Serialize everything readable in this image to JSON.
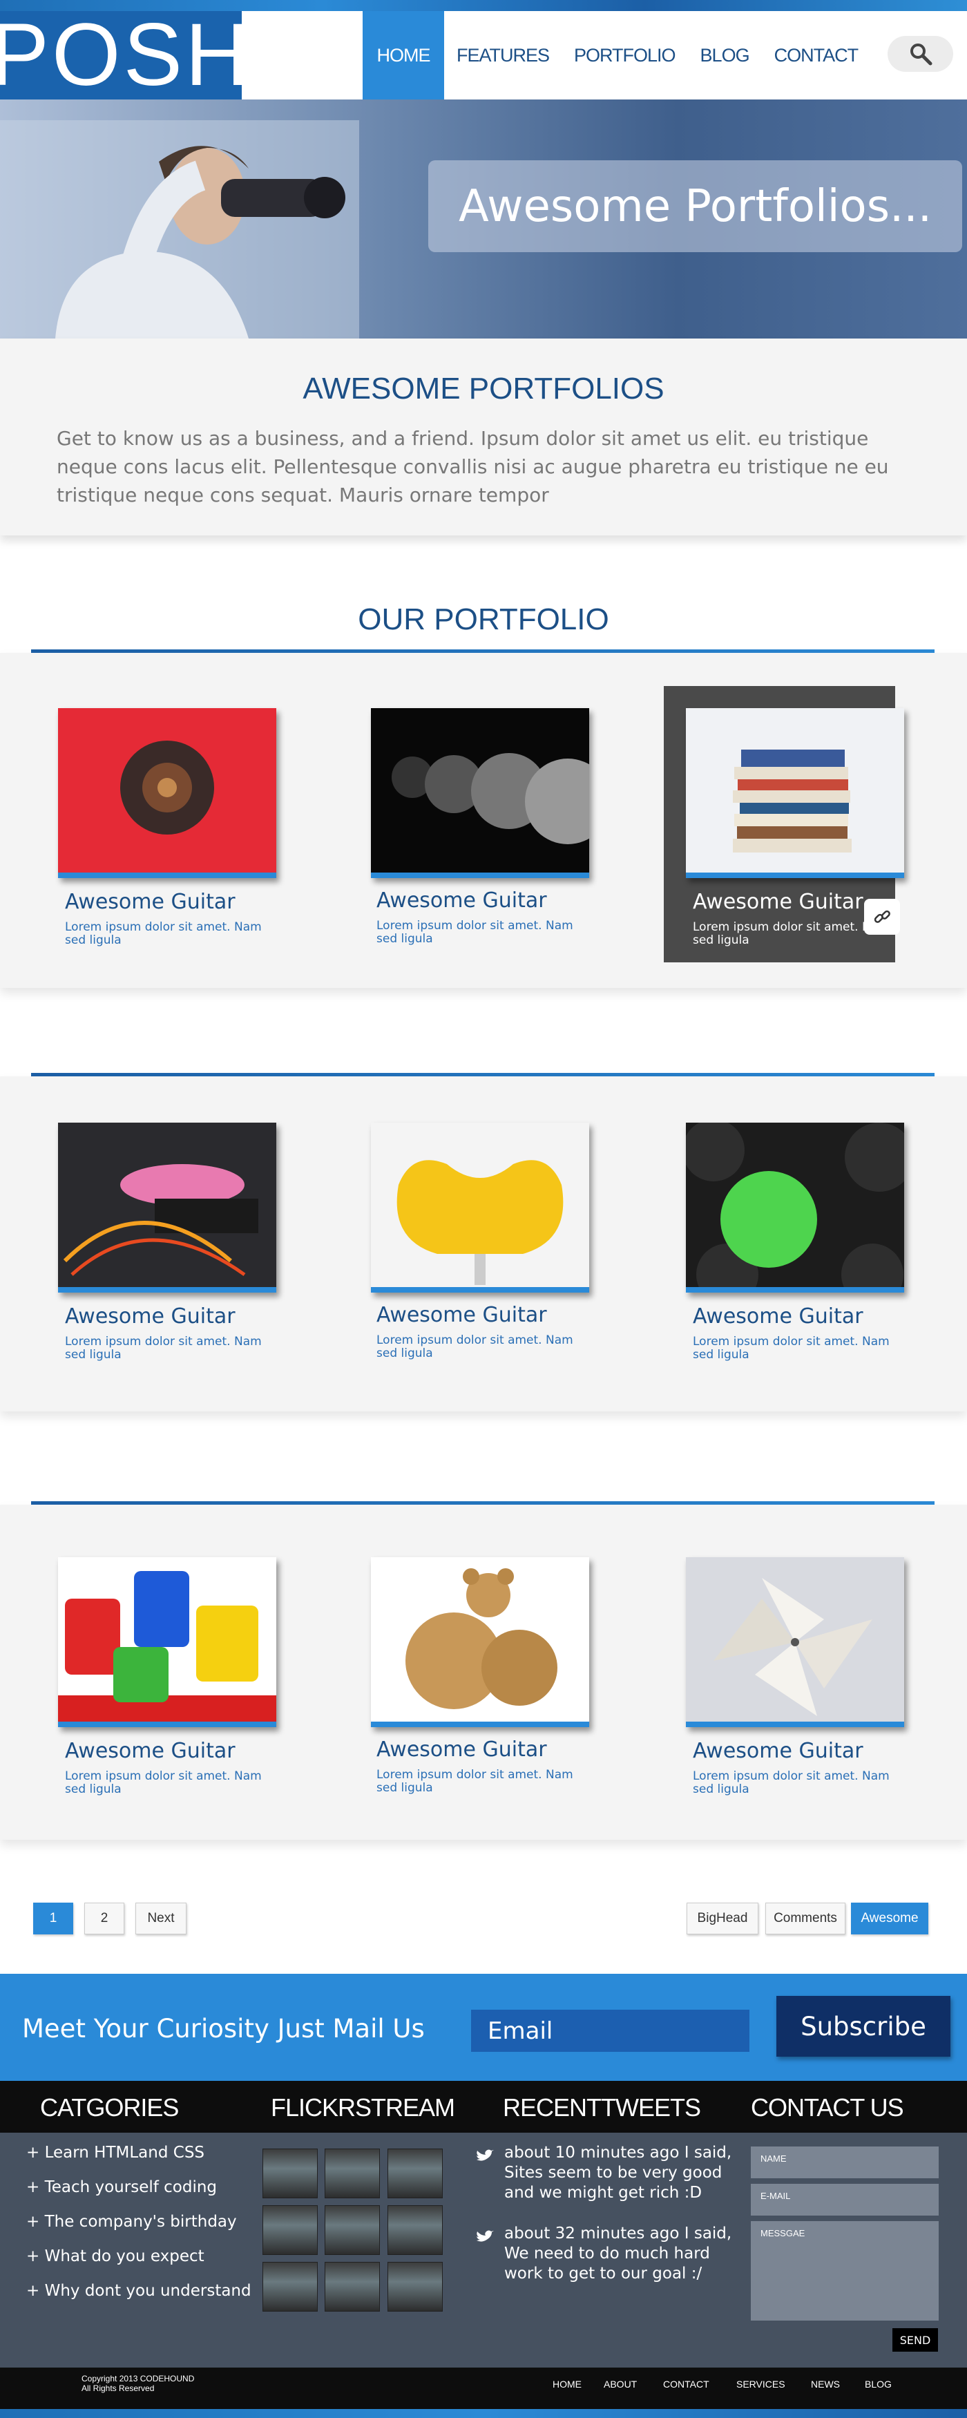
{
  "logo": {
    "text": "POSH"
  },
  "nav": {
    "items": [
      "HOME",
      "FEATURES",
      "PORTFOLIO",
      "BLOG",
      "CONTACT"
    ],
    "active": "HOME"
  },
  "hero": {
    "title": "Awesome Portfolios..."
  },
  "about": {
    "heading": "AWESOME PORTFOLIOS",
    "text": "Get to know us as a business, and a friend. Ipsum dolor sit amet us elit. eu tristique neque cons lacus elit. Pellentesque convallis nisi ac augue pharetra eu tristique ne eu tristique neque cons sequat. Mauris ornare tempor"
  },
  "portfolio": {
    "heading": "OUR PORTFOLIO",
    "items": [
      {
        "title": "Awesome Guitar",
        "desc": "Lorem ipsum dolor sit amet. Nam sed ligula",
        "image": "red-object"
      },
      {
        "title": "Awesome Guitar",
        "desc": "Lorem ipsum dolor sit amet. Nam sed ligula",
        "image": "dark-spheres"
      },
      {
        "title": "Awesome Guitar",
        "desc": "Lorem ipsum dolor sit amet. Nam sed ligula",
        "image": "book-stack"
      },
      {
        "title": "Awesome Guitar",
        "desc": "Lorem ipsum dolor sit amet. Nam sed ligula",
        "image": "sandals"
      },
      {
        "title": "Awesome Guitar",
        "desc": "Lorem ipsum dolor sit amet. Nam sed ligula",
        "image": "yellow-chair"
      },
      {
        "title": "Awesome Guitar",
        "desc": "Lorem ipsum dolor sit amet. Nam sed ligula",
        "image": "green-umbrella"
      },
      {
        "title": "Awesome Guitar",
        "desc": "Lorem ipsum dolor sit amet. Nam sed ligula",
        "image": "paint-buckets"
      },
      {
        "title": "Awesome Guitar",
        "desc": "Lorem ipsum dolor sit amet. Nam sed ligula",
        "image": "teddy-bear"
      },
      {
        "title": "Awesome Guitar",
        "desc": "Lorem ipsum dolor sit amet. Nam sed ligula",
        "image": "pinwheel"
      }
    ]
  },
  "pagination": {
    "pages": [
      "1",
      "2"
    ],
    "next": "Next",
    "active": "1"
  },
  "filters": {
    "items": [
      "BigHead",
      "Comments",
      "Awesome"
    ],
    "active": "Awesome"
  },
  "subscribe": {
    "text": "Meet Your Curiosity Just Mail Us",
    "email_placeholder": "Email",
    "button": "Subscribe"
  },
  "footer": {
    "headings": {
      "categories": "CATGORIES",
      "flickr": "FLICKRSTREAM",
      "tweets": "RECENTTWEETS",
      "contact": "CONTACT US"
    },
    "categories": [
      "+ Learn HTMLand CSS",
      "+ Teach yourself coding",
      "+ The company's birthday",
      "+ What do you expect",
      "+ Why dont you understand"
    ],
    "tweets": [
      "about 10 minutes ago I said, Sites seem to be very good and we might get rich :D",
      "about 32 minutes ago I said, We need to do much hard work to get to our goal :/"
    ],
    "contact": {
      "name_placeholder": "NAME",
      "email_placeholder": "E-MAIL",
      "message_placeholder": "MESSGAE",
      "send": "SEND"
    },
    "copyright": [
      "Copyright 2013 CODEHOUND",
      "All Rights Reserved"
    ],
    "links": [
      "HOME",
      "ABOUT",
      "CONTACT",
      "SERVICES",
      "NEWS",
      "BLOG"
    ]
  },
  "colors": {
    "primary": "#2a8ad8",
    "dark_blue": "#1c4f86",
    "footer_bg": "#465160"
  }
}
